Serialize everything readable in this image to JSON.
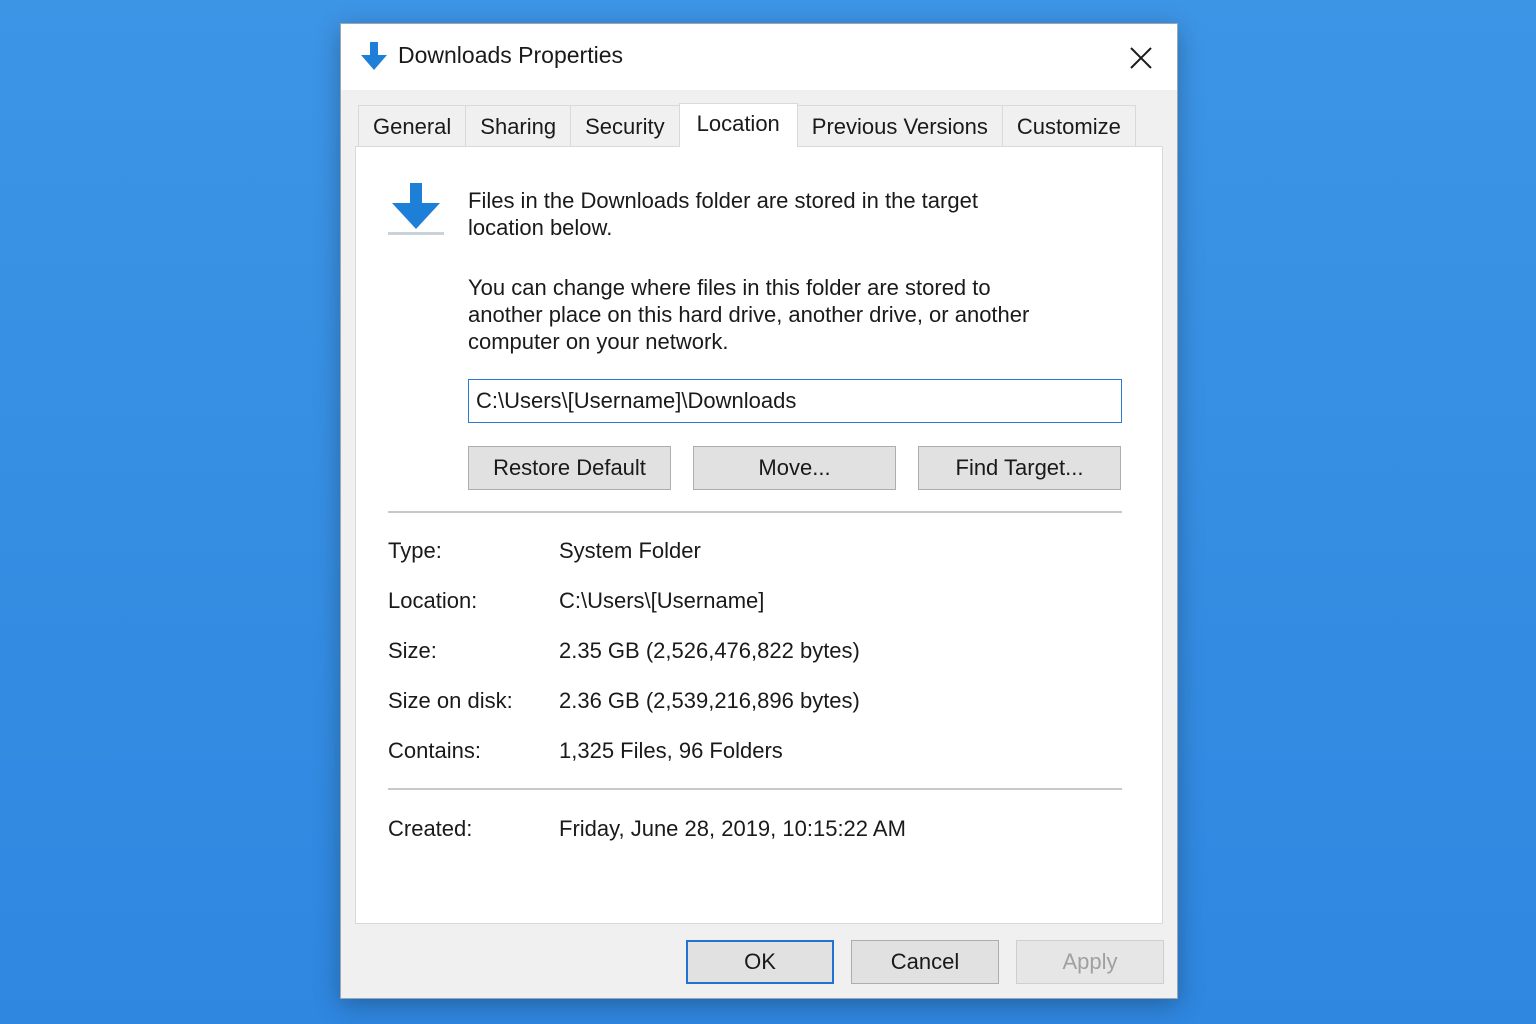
{
  "window": {
    "title": "Downloads Properties",
    "title_icon": "download-arrow-icon",
    "close_icon": "close-icon"
  },
  "tabs": [
    {
      "label": "General",
      "active": false
    },
    {
      "label": "Sharing",
      "active": false
    },
    {
      "label": "Security",
      "active": false
    },
    {
      "label": "Location",
      "active": true
    },
    {
      "label": "Previous Versions",
      "active": false
    },
    {
      "label": "Customize",
      "active": false
    }
  ],
  "location": {
    "icon": "download-folder-icon",
    "intro": "Files in the Downloads folder are stored in the target location below.",
    "description": "You can change where files in this folder are stored to another place on this hard drive, another drive, or another computer on your network.",
    "path_value": "C:\\Users\\[Username]\\Downloads",
    "buttons": {
      "restore": "Restore Default",
      "move": "Move...",
      "find": "Find Target..."
    }
  },
  "properties": [
    {
      "label": "Type:",
      "value": "System Folder"
    },
    {
      "label": "Location:",
      "value": "C:\\Users\\[Username]"
    },
    {
      "label": "Size:",
      "value": "2.35 GB (2,526,476,822 bytes)"
    },
    {
      "label": "Size on disk:",
      "value": "2.36 GB (2,539,216,896 bytes)"
    },
    {
      "label": "Contains:",
      "value": "1,325 Files, 96 Folders"
    }
  ],
  "created": {
    "label": "Created:",
    "value": "Friday, June 28, 2019, 10:15:22 AM"
  },
  "footer": {
    "ok": "OK",
    "cancel": "Cancel",
    "apply": "Apply",
    "apply_enabled": false
  },
  "colors": {
    "desktop": "#3d95e6",
    "accent": "#1f73d2",
    "icon_blue": "#1e7fd8"
  }
}
